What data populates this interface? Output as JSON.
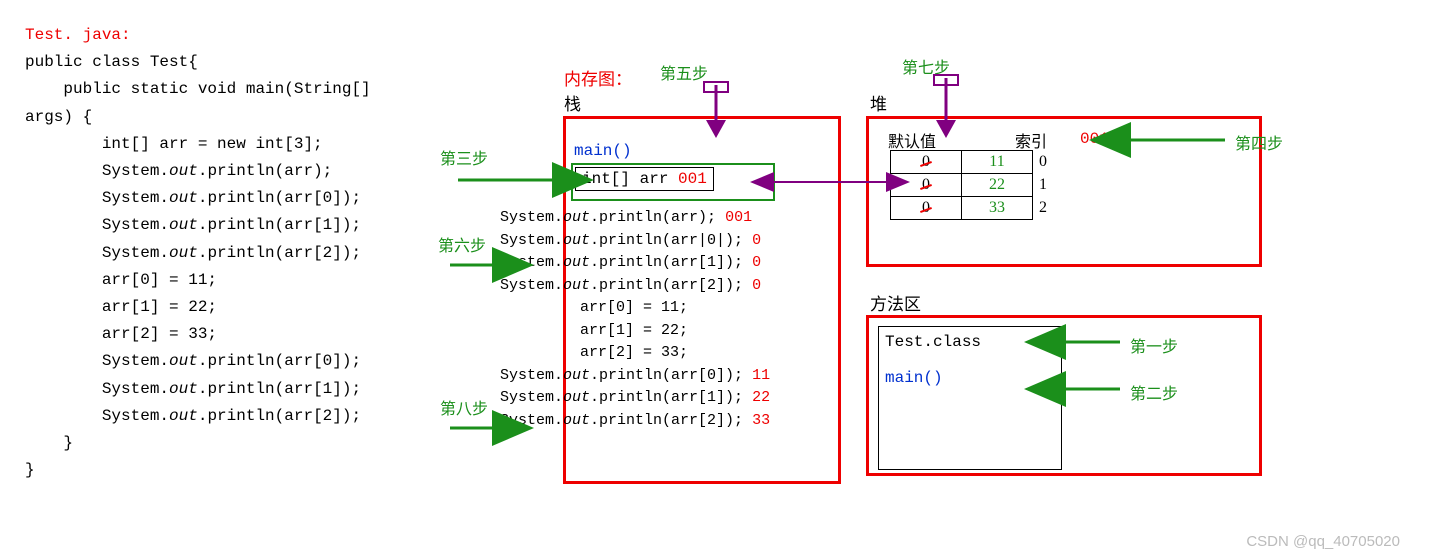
{
  "code": {
    "filename": "Test. java:",
    "l1": "public class Test{",
    "l2": "    public static void main(String[]",
    "l3": "args) {",
    "l4": "        int[] arr = new int[3];",
    "l5": "        System.",
    "out": "out",
    "p1": ".println(arr);",
    "p2": ".println(arr[0]);",
    "p3": ".println(arr[1]);",
    "p4": ".println(arr[2]);",
    "a1": "        arr[0] = 11;",
    "a2": "        arr[1] = 22;",
    "a3": "        arr[2] = 33;",
    "close1": "    }",
    "close2": "}"
  },
  "labels": {
    "memtitle": "内存图：",
    "stack": "栈",
    "heap": "堆",
    "method_area": "方法区",
    "step1": "第一步",
    "step2": "第二步",
    "step3": "第三步",
    "step4": "第四步",
    "step5": "第五步",
    "step6": "第六步",
    "step7": "第七步",
    "step8": "第八步",
    "defval": "默认值",
    "index": "索引"
  },
  "stack": {
    "main": "main()",
    "arrbox": "int[] arr ",
    "addr": "001",
    "s1": "System.",
    "s1b": ".println(arr);",
    "s2": "System.",
    "s2b": ".println(arr|0|);",
    "s3": "System.",
    "s3b": ".println(arr[1]);",
    "s4": "System.",
    "s4b": ".println(arr[2]);",
    "a1": "arr[0] = 11;",
    "a2": "arr[1] = 22;",
    "a3": "arr[2] = 33;",
    "s5": "System.",
    "s5b": ".println(arr[0]);",
    "s6": "System.",
    "s6b": ".println(arr[1]);",
    "s7": "System.",
    "s7b": ".println(arr[2]);",
    "o1": "001",
    "o2": "0",
    "o3": "0",
    "o4": "0",
    "o5": "11",
    "o6": "22",
    "o7": "33"
  },
  "heap": {
    "addr": "001",
    "rows": [
      {
        "old": "0",
        "new": "11",
        "idx": "0"
      },
      {
        "old": "0",
        "new": "22",
        "idx": "1"
      },
      {
        "old": "0",
        "new": "33",
        "idx": "2"
      }
    ]
  },
  "method": {
    "classfile": "Test.class",
    "main": "main()"
  },
  "watermark": "CSDN @qq_40705020"
}
